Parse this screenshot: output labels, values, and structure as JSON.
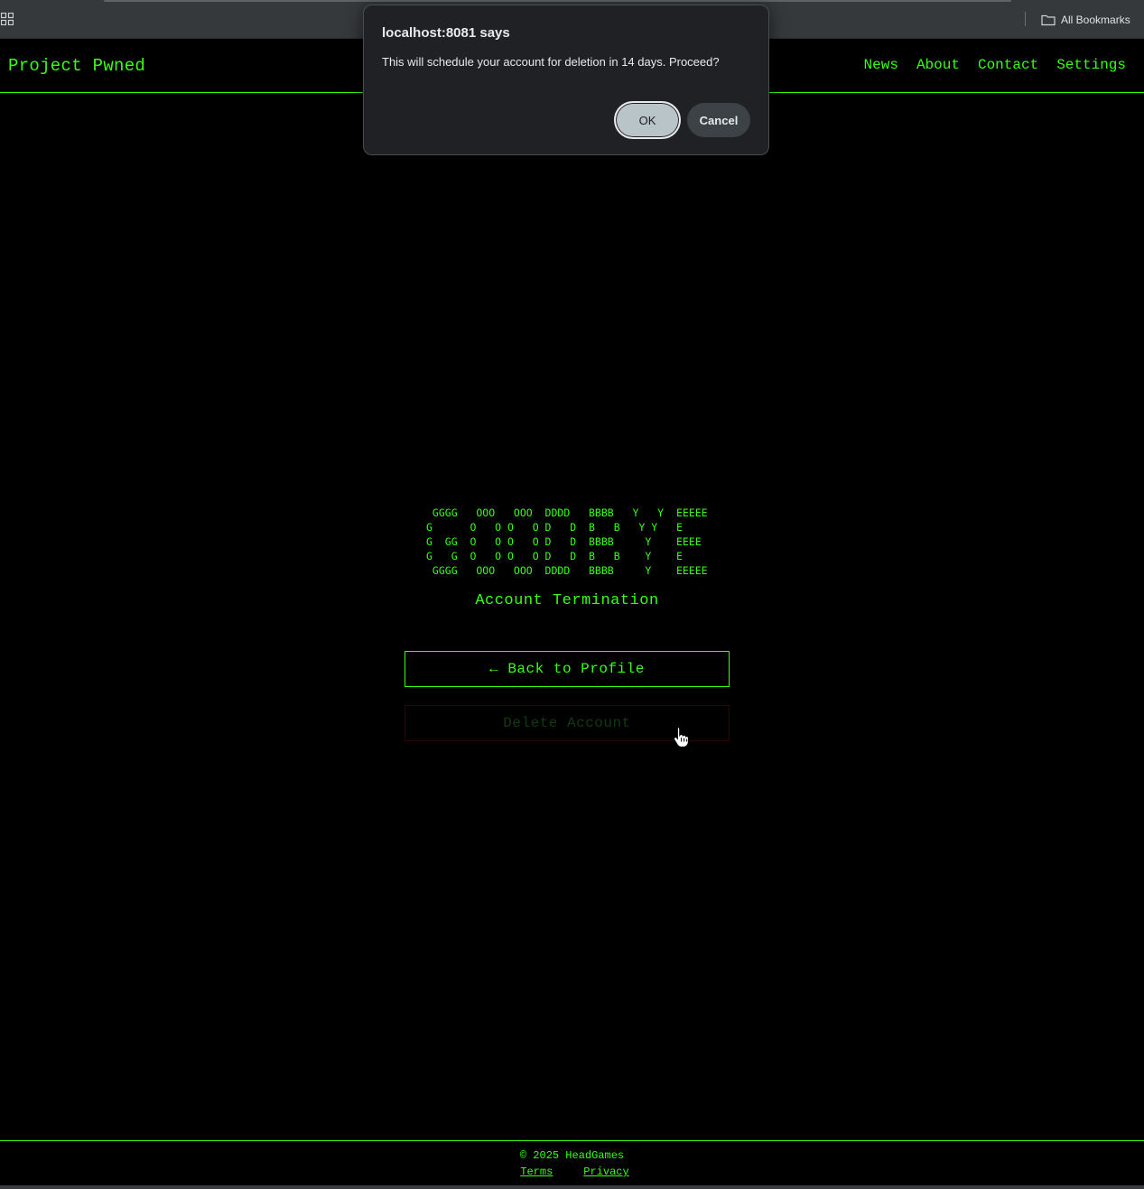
{
  "browser": {
    "bookmarks_label": "All Bookmarks"
  },
  "header": {
    "title": "Project Pwned",
    "nav": [
      "News",
      "About",
      "Contact",
      "Settings"
    ]
  },
  "main": {
    "ascii_art": " GGGG   OOO   OOO  DDDD   BBBB   Y   Y  EEEEE\nG      O   O O   O D   D  B   B   Y Y   E\nG  GG  O   O O   O D   D  BBBB     Y    EEEE\nG   G  O   O O   O D   D  B   B    Y    E\n GGGG   OOO   OOO  DDDD   BBBB     Y    EEEEE",
    "heading": "Account Termination",
    "back_button": "← Back to Profile",
    "delete_button": "Delete Account"
  },
  "footer": {
    "copyright": "© 2025 HeadGames",
    "terms": "Terms",
    "privacy": "Privacy"
  },
  "dialog": {
    "title": "localhost:8081 says",
    "message": "This will schedule your account for deletion in 14 days. Proceed?",
    "ok_label": "OK",
    "cancel_label": "Cancel"
  },
  "colors": {
    "accent": "#39ff14",
    "background": "#000000",
    "dialog_bg": "#202124"
  }
}
